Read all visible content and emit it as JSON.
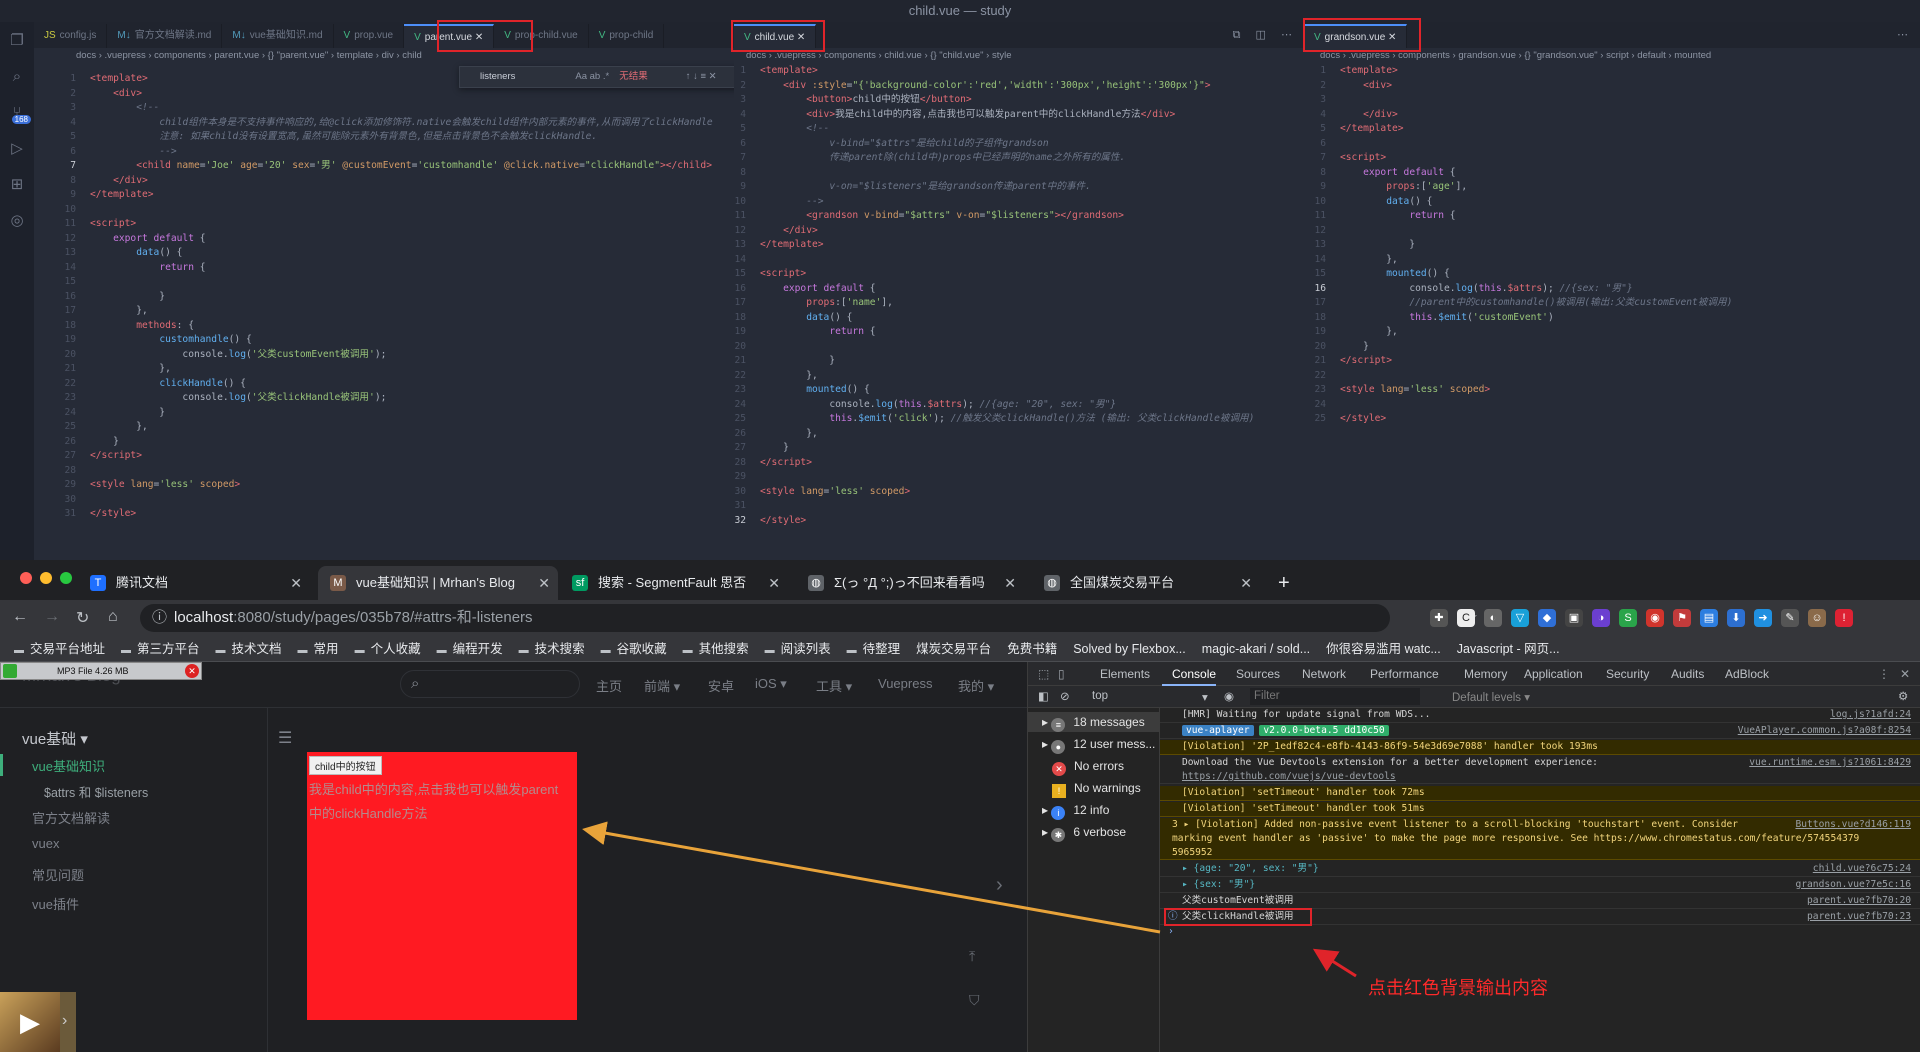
{
  "window_title": "child.vue — study",
  "activity": {
    "scm_badge": "168"
  },
  "left": {
    "tabs": [
      "config.js",
      "官方文档解读.md",
      "vue基础知识.md",
      "prop.vue",
      "parent.vue",
      "prop-child.vue",
      "prop-child"
    ],
    "breadcrumb": "docs › .vuepress › components › parent.vue › {} \"parent.vue\" › template › div › child",
    "find": {
      "query": "listeners",
      "opts": "Aa  ab  .*",
      "result": "无结果",
      "tools": "↑  ↓  ≡  ✕"
    }
  },
  "mid": {
    "tab": "child.vue",
    "breadcrumb": "docs › .vuepress › components › child.vue › {} \"child.vue\" › style"
  },
  "right": {
    "tab": "grandson.vue",
    "breadcrumb": "docs › .vuepress › components › grandson.vue › {} \"grandson.vue\" › script › default › mounted"
  },
  "browser": {
    "tabs": [
      {
        "title": "腾讯文档"
      },
      {
        "title": "vue基础知识 | Mrhan's Blog"
      },
      {
        "title": "搜索 - SegmentFault 思否"
      },
      {
        "title": "Σ(っ °Д °;)っ不回来看看吗"
      },
      {
        "title": "全国煤炭交易平台"
      }
    ],
    "url_host": "localhost",
    "url_path": ":8080/study/pages/035b78/#attrs-和-listeners",
    "bookmarks": [
      "交易平台地址",
      "第三方平台",
      "技术文档",
      "常用",
      "个人收藏",
      "编程开发",
      "技术搜索",
      "谷歌收藏",
      "其他搜索",
      "阅读列表",
      "待整理",
      "煤炭交易平台",
      "免费书籍",
      "Solved by Flexbox...",
      "magic-akari / sold...",
      "你很容易滥用 watc...",
      "Javascript - 网页..."
    ]
  },
  "page": {
    "logo": "Mrhan's Blog",
    "nav": [
      "主页",
      "前端 ▾",
      "安卓",
      "iOS ▾",
      "工具 ▾",
      "Vuepress",
      "我的 ▾"
    ],
    "mp3": "MP3 File 4.26 MB",
    "sidebar": {
      "group": "vue基础 ▾",
      "active": "vue基础知识",
      "sub": "$attrs 和 $listeners",
      "items": [
        "官方文档解读",
        "vuex",
        "常见问题",
        "vue插件"
      ]
    },
    "demo_button": "child中的按钮",
    "demo_text": "我是child中的内容,点击我也可以触发parent中的clickHandle方法"
  },
  "devtools": {
    "tabs": [
      "Elements",
      "Console",
      "Sources",
      "Network",
      "Performance",
      "Memory",
      "Application",
      "Security",
      "Audits",
      "AdBlock"
    ],
    "context": "top",
    "filter": "Filter",
    "levels": "Default levels ▾",
    "sidebar": [
      "18 messages",
      "12 user mess...",
      "No errors",
      "No warnings",
      "12 info",
      "6 verbose"
    ],
    "console": [
      {
        "text": "[HMR] Waiting for update signal from WDS...",
        "src": "log.js?1afd:24"
      },
      {
        "text": "vue-aplayer",
        "text2": "v2.0.0-beta.5 dd10c50",
        "src": "VueAPlayer.common.js?a08f:8254"
      },
      {
        "text": "[Violation] '2P_1edf82c4-e8fb-4143-86f9-54e3d69e7088' handler took 193ms",
        "src": ""
      },
      {
        "text": "Download the Vue Devtools extension for a better development experience:",
        "text2": "https://github.com/vuejs/vue-devtools",
        "src": "vue.runtime.esm.js?1061:8429"
      },
      {
        "text": "[Violation] 'setTimeout' handler took 72ms",
        "src": ""
      },
      {
        "text": "[Violation] 'setTimeout' handler took 51ms",
        "src": ""
      },
      {
        "text": "3 ▸ [Violation] Added non-passive event listener to a scroll-blocking 'touchstart' event. Consider",
        "text2": "marking event handler as 'passive' to make the page more responsive. See https://www.chromestatus.com/feature/574554379",
        "text3": "5965952",
        "src": "Buttons.vue?d146:119"
      },
      {
        "text": "▸ {age: \"20\", sex: \"男\"}",
        "src": "child.vue?6c75:24"
      },
      {
        "text": "▸ {sex: \"男\"}",
        "src": "grandson.vue?7e5c:16"
      },
      {
        "text": "父类customEvent被调用",
        "src": "parent.vue?fb70:20"
      },
      {
        "text": "父类clickHandle被调用",
        "src": "parent.vue?fb70:23"
      }
    ]
  },
  "annotation": "点击红色背景输出内容"
}
